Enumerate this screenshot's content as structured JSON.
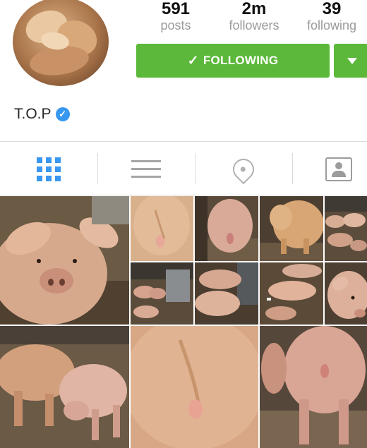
{
  "profile": {
    "username": "T.O.P",
    "stats": {
      "posts": {
        "value": "591",
        "label": "posts"
      },
      "followers": {
        "value": "2m",
        "label": "followers"
      },
      "following": {
        "value": "39",
        "label": "following"
      }
    },
    "follow_button": {
      "label": "FOLLOWING",
      "icon": "check-icon"
    },
    "dropdown_icon": "caret-down-icon",
    "verified_icon": "verified-badge-icon"
  },
  "tabs": [
    {
      "name": "grid",
      "icon": "grid-icon",
      "active": true
    },
    {
      "name": "list",
      "icon": "list-icon",
      "active": false
    },
    {
      "name": "map",
      "icon": "location-pin-icon",
      "active": false
    },
    {
      "name": "tagged",
      "icon": "tagged-person-icon",
      "active": false
    }
  ],
  "colors": {
    "follow_green": "#5cb83a",
    "active_blue": "#3897f0",
    "verified_blue": "#3897f0"
  },
  "photos": [
    {
      "subject": "pig-face"
    },
    {
      "subject": "pig-rear-closeup"
    },
    {
      "subject": "pig-rear-barn"
    },
    {
      "subject": "pig-standing"
    },
    {
      "subject": "pigs-herd"
    },
    {
      "subject": "pigs-group"
    },
    {
      "subject": "pigs-lying"
    },
    {
      "subject": "pigs-sleeping"
    },
    {
      "subject": "pigs-barn-floor"
    },
    {
      "subject": "pig-head-close"
    },
    {
      "subject": "pigs-feeding"
    },
    {
      "subject": "pig-rear-macro"
    },
    {
      "subject": "pig-rear-standing"
    }
  ]
}
